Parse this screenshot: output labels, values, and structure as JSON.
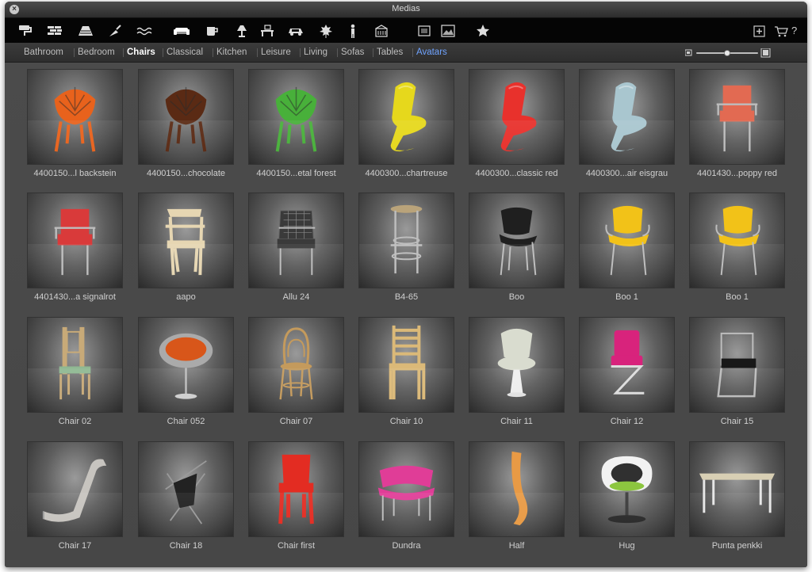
{
  "window": {
    "title": "Medias"
  },
  "toolbar": {
    "icons": [
      {
        "name": "paint-roller-icon"
      },
      {
        "name": "brick-wall-icon"
      },
      {
        "name": "roof-tiles-icon"
      },
      {
        "name": "trowel-icon"
      },
      {
        "name": "water-icon"
      },
      {
        "name": "sofa-icon",
        "active": true
      },
      {
        "name": "cup-icon"
      },
      {
        "name": "lamp-icon"
      },
      {
        "name": "desk-icon"
      },
      {
        "name": "car-icon"
      },
      {
        "name": "leaf-icon"
      },
      {
        "name": "person-icon"
      },
      {
        "name": "building-icon"
      },
      {
        "name": "texture-icon"
      },
      {
        "name": "image-icon"
      },
      {
        "name": "star-icon"
      }
    ],
    "right_icons": [
      {
        "name": "new-folder-icon"
      },
      {
        "name": "cart-icon"
      },
      {
        "name": "help-icon",
        "glyph": "?"
      }
    ]
  },
  "categories": [
    {
      "label": "Bathroom"
    },
    {
      "label": "Bedroom"
    },
    {
      "label": "Chairs",
      "selected": true
    },
    {
      "label": "Classical"
    },
    {
      "label": "Kitchen"
    },
    {
      "label": "Leisure"
    },
    {
      "label": "Living"
    },
    {
      "label": "Sofas"
    },
    {
      "label": "Tables"
    },
    {
      "label": "Avatars",
      "link": true
    }
  ],
  "zoom": {
    "level": 0.5
  },
  "items": [
    {
      "label": "4400150...l backstein",
      "shape": "vegetal",
      "color": "#e8621c"
    },
    {
      "label": "4400150...chocolate",
      "shape": "vegetal",
      "color": "#5a2a14"
    },
    {
      "label": "4400150...etal forest",
      "shape": "vegetal",
      "color": "#48b03a"
    },
    {
      "label": "4400300...chartreuse",
      "shape": "panton",
      "color": "#e6d81c"
    },
    {
      "label": "4400300...classic red",
      "shape": "panton",
      "color": "#e8312c"
    },
    {
      "label": "4400300...air eisgrau",
      "shape": "panton",
      "color": "#a9c6cf"
    },
    {
      "label": "4401430...poppy red",
      "shape": "armchair",
      "color": "#e26a52"
    },
    {
      "label": "4401430...a signalrot",
      "shape": "armchair",
      "color": "#d93a3a"
    },
    {
      "label": "aapo",
      "shape": "wood",
      "color": "#e6d6b2"
    },
    {
      "label": "Allu 24",
      "shape": "mesh",
      "color": "#3a3a3a"
    },
    {
      "label": "B4-65",
      "shape": "stool",
      "color": "#b9a37a"
    },
    {
      "label": "Boo",
      "shape": "shell",
      "color": "#1f1f1f"
    },
    {
      "label": "Boo 1",
      "shape": "shell-arms",
      "color": "#f2c218"
    },
    {
      "label": "Boo 1",
      "shape": "shell-arms",
      "color": "#f2c218"
    },
    {
      "label": "Chair 02",
      "shape": "tall",
      "color": "#c8aa78"
    },
    {
      "label": "Chair 052",
      "shape": "egg",
      "color": "#d8561a"
    },
    {
      "label": "Chair 07",
      "shape": "bentwood",
      "color": "#c49a5c"
    },
    {
      "label": "Chair 10",
      "shape": "ladder",
      "color": "#dbb978"
    },
    {
      "label": "Chair 11",
      "shape": "tulip",
      "color": "#d9dccf"
    },
    {
      "label": "Chair 12",
      "shape": "zigzag",
      "color": "#d8237c"
    },
    {
      "label": "Chair 15",
      "shape": "cantilever",
      "color": "#181818"
    },
    {
      "label": "Chair 17",
      "shape": "lounge",
      "color": "#c7c4bf"
    },
    {
      "label": "Chair 18",
      "shape": "butterfly",
      "color": "#222222"
    },
    {
      "label": "Chair first",
      "shape": "plastic",
      "color": "#e32c22"
    },
    {
      "label": "Dundra",
      "shape": "bench",
      "color": "#e03d97"
    },
    {
      "label": "Half",
      "shape": "half",
      "color": "#e89a45"
    },
    {
      "label": "Hug",
      "shape": "hug",
      "color": "#f2f2f2"
    },
    {
      "label": "Punta penkki",
      "shape": "table",
      "color": "#d8cfb4"
    }
  ]
}
